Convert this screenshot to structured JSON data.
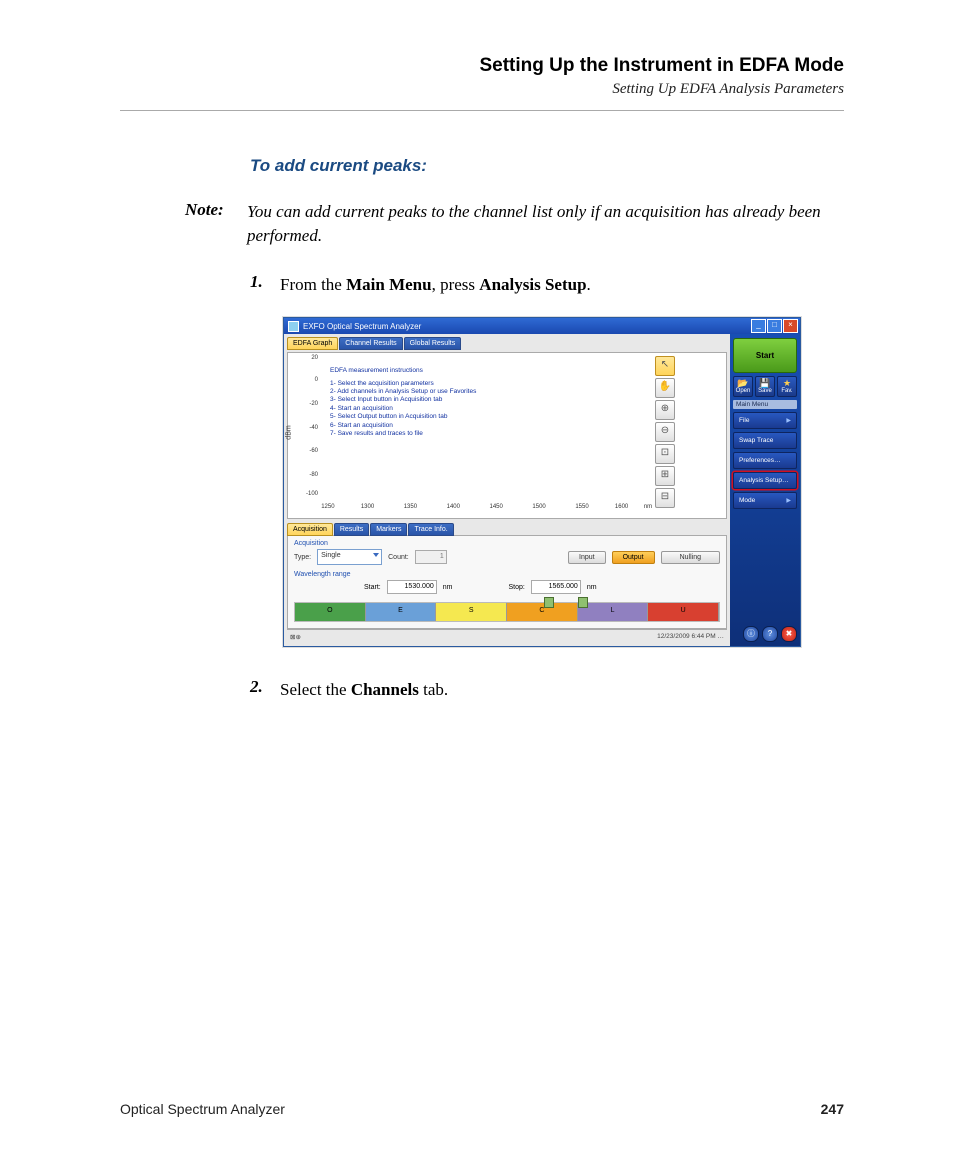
{
  "header": {
    "title": "Setting Up the Instrument in EDFA Mode",
    "subtitle": "Setting Up EDFA Analysis Parameters"
  },
  "section_heading": "To add current peaks:",
  "note": {
    "label": "Note:",
    "text": "You can add current peaks to the channel list only if an acquisition has already been performed."
  },
  "steps": [
    {
      "num": "1.",
      "prefix": "From the ",
      "b1": "Main Menu",
      "mid": ", press ",
      "b2": "Analysis Setup",
      "suffix": "."
    },
    {
      "num": "2.",
      "prefix": "Select the ",
      "b1": "Channels",
      "mid": " tab.",
      "b2": "",
      "suffix": ""
    }
  ],
  "window": {
    "title": "EXFO Optical Spectrum Analyzer",
    "tabs_top": [
      "EDFA Graph",
      "Channel Results",
      "Global Results"
    ],
    "tabs_bottom": [
      "Acquisition",
      "Results",
      "Markers",
      "Trace Info."
    ],
    "instructions": {
      "title": "EDFA measurement instructions",
      "lines": [
        "1- Select the acquisition parameters",
        "2- Add channels in Analysis Setup or use Favorites",
        "3- Select Input button in Acquisition tab",
        "4- Start an acquisition",
        "5- Select Output button in Acquisition tab",
        "6- Start an acquisition",
        "7- Save results and traces to file"
      ]
    },
    "acquisition": {
      "group": "Acquisition",
      "type_label": "Type:",
      "type_value": "Single",
      "count_label": "Count:",
      "count_value": "1",
      "btn_input": "Input",
      "btn_output": "Output",
      "btn_nulling": "Nulling"
    },
    "wavelength": {
      "group": "Wavelength range",
      "start_label": "Start:",
      "start_value": "1530.000",
      "start_unit": "nm",
      "stop_label": "Stop:",
      "stop_value": "1565.000",
      "stop_unit": "nm"
    },
    "bands": [
      "O",
      "E",
      "S",
      "C",
      "L",
      "U"
    ],
    "band_colors": [
      "#4aa04a",
      "#6aa0d8",
      "#f5e850",
      "#f0a020",
      "#6050a0",
      "#d03020"
    ],
    "side": {
      "start": "Start",
      "open": "Open",
      "save": "Save",
      "fav": "Fav.",
      "main_menu": "Main Menu",
      "file": "File",
      "swap": "Swap Trace",
      "prefs": "Preferences…",
      "analysis": "Analysis Setup…",
      "mode": "Mode"
    },
    "statusbar": {
      "left": "⊠⊕",
      "right": "12/23/2009 6:44 PM …"
    }
  },
  "chart_data": {
    "type": "line",
    "title": "",
    "xlabel": "nm",
    "ylabel": "dBm",
    "x_ticks": [
      1250,
      1300,
      1350,
      1400,
      1450,
      1500,
      1550,
      1600
    ],
    "y_ticks": [
      20,
      0,
      -20,
      -40,
      -60,
      -80,
      -100
    ],
    "xlim": [
      1250,
      1650
    ],
    "ylim": [
      -100,
      20
    ],
    "series": []
  },
  "footer": {
    "left": "Optical Spectrum Analyzer",
    "right": "247"
  }
}
